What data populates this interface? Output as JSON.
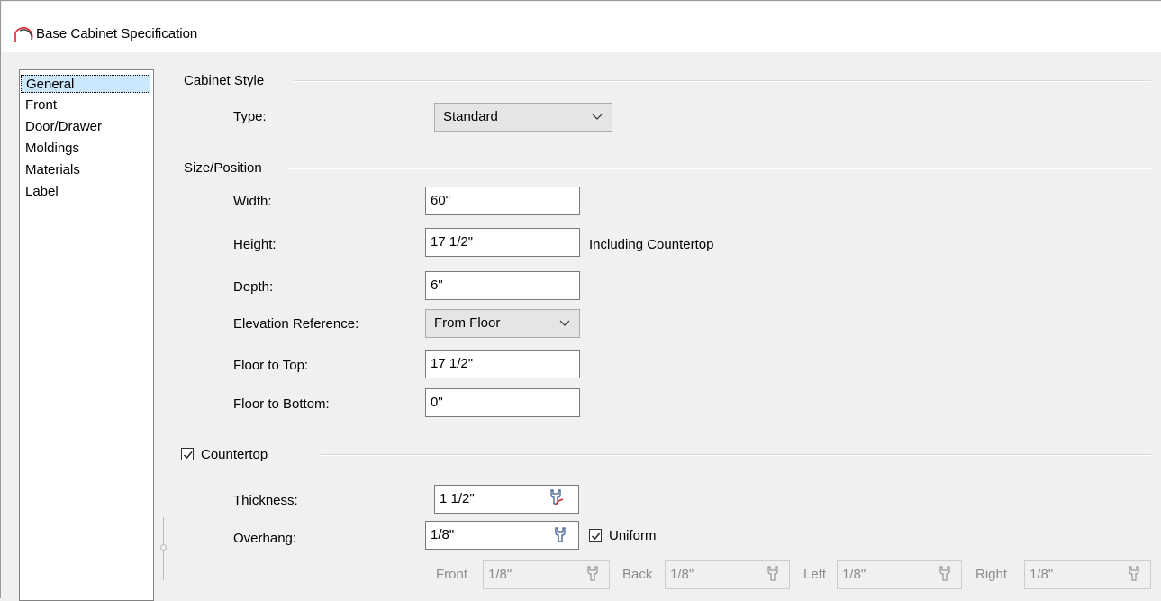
{
  "window": {
    "title": "Base Cabinet Specification",
    "icon": "cabinet-arc-icon"
  },
  "nav": {
    "items": [
      {
        "label": "General",
        "selected": true
      },
      {
        "label": "Front"
      },
      {
        "label": "Door/Drawer"
      },
      {
        "label": "Moldings"
      },
      {
        "label": "Materials"
      },
      {
        "label": "Label"
      }
    ]
  },
  "cabinet_style": {
    "title": "Cabinet Style",
    "type_label": "Type:",
    "type_value": "Standard"
  },
  "size_position": {
    "title": "Size/Position",
    "width_label": "Width:",
    "width_value": "60\"",
    "height_label": "Height:",
    "height_value": "17 1/2\"",
    "height_note": "Including Countertop",
    "depth_label": "Depth:",
    "depth_value": "6\"",
    "elevation_label": "Elevation Reference:",
    "elevation_value": "From Floor",
    "floor_top_label": "Floor to Top:",
    "floor_top_value": "17 1/2\"",
    "floor_bottom_label": "Floor to Bottom:",
    "floor_bottom_value": "0\""
  },
  "countertop": {
    "title": "Countertop",
    "checked": true,
    "thickness_label": "Thickness:",
    "thickness_value": "1 1/2\"",
    "overhang_label": "Overhang:",
    "overhang_value": "1/8\"",
    "uniform_label": "Uniform",
    "uniform_checked": true,
    "front_label": "Front",
    "front_value": "1/8\"",
    "back_label": "Back",
    "back_value": "1/8\"",
    "left_label": "Left",
    "left_value": "1/8\"",
    "right_label": "Right",
    "right_value": "1/8\""
  },
  "colors": {
    "selection": "#cce8ff",
    "accent_red": "#d9272e",
    "wrench_blue": "#3c5a8c"
  }
}
